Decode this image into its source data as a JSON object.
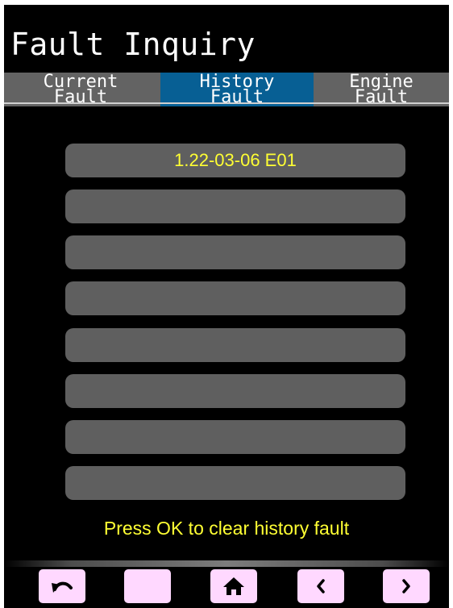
{
  "title": "Fault Inquiry",
  "tabs": [
    {
      "line1": "Current",
      "line2": "Fault",
      "selected": false
    },
    {
      "line1": "History",
      "line2": "Fault",
      "selected": true
    },
    {
      "line1": "Engine",
      "line2": "Fault",
      "selected": false
    }
  ],
  "history_list": [
    "1.22-03-06 E01",
    "",
    "",
    "",
    "",
    "",
    "",
    ""
  ],
  "hint": "Press OK to clear history fault",
  "nav_buttons": [
    {
      "icon": "back-icon"
    },
    {
      "icon": "blank"
    },
    {
      "icon": "home-icon"
    },
    {
      "icon": "chevron-left-icon"
    },
    {
      "icon": "chevron-right-icon"
    }
  ],
  "colors": {
    "background": "#000000",
    "tab_bar": "#636363",
    "tab_selected": "#075f94",
    "slot": "#5f5f5f",
    "accent_text": "#ffff33",
    "nav_button": "#ffd8ff"
  }
}
